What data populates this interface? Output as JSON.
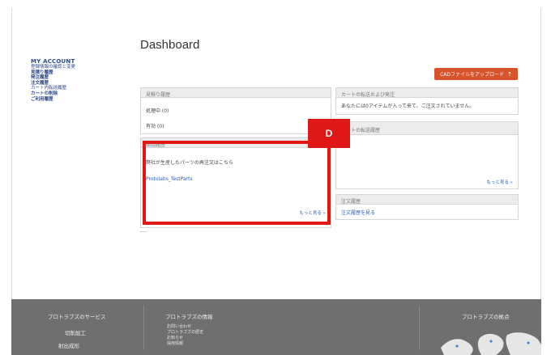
{
  "header": {
    "title": "Dashboard",
    "upload_label": "CADファイルをアップロード"
  },
  "sidebar": {
    "heading": "MY ACCOUNT",
    "items": [
      {
        "label": "登録情報の確認と変更"
      },
      {
        "label": "見積り履歴"
      },
      {
        "label": "発注履歴"
      },
      {
        "label": "注文履歴"
      },
      {
        "label": "カート内転送履歴"
      },
      {
        "label": "カートの削除"
      },
      {
        "label": "ご利用履歴"
      }
    ]
  },
  "quote_history": {
    "title": "見積り履歴",
    "rows": [
      "処理中 (0)",
      "有効 (0)"
    ]
  },
  "parts_panel": {
    "title": "部品履歴",
    "text": "弊社が生産したパーツの再注文はこちら",
    "link": "Protolabs_TestParts",
    "more": "もっと見る »"
  },
  "cart_transfer": {
    "title": "カートの転送および発注",
    "text": "あなたには0アイテムが入って来て、ご注文されていません。"
  },
  "cart_history": {
    "title": "カートの転送履歴",
    "more": "もっと見る »"
  },
  "order_history": {
    "title": "注文履歴",
    "link": "注文履歴を見る"
  },
  "marker": {
    "label": "D"
  },
  "colors": {
    "accent": "#d9532a",
    "highlight": "#e01717",
    "footer": "#6f6f6f",
    "link": "#2b62b5"
  },
  "footer": {
    "services": {
      "title": "プロトラブズのサービス",
      "items": [
        "切削加工",
        "射出成形"
      ]
    },
    "company": {
      "title": "プロトラブズの情報",
      "items": [
        "お問い合わせ",
        "プロトラブズの歴史",
        "お知らせ",
        "採用情報"
      ]
    },
    "locations": {
      "title": "プロトラブズの拠点"
    }
  }
}
